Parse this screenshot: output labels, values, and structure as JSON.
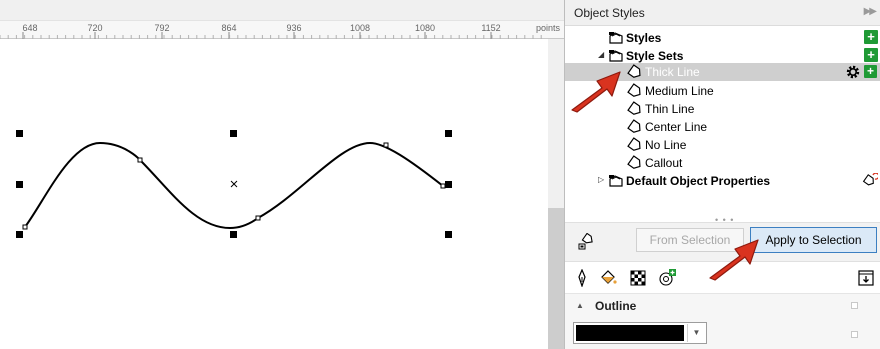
{
  "ruler": {
    "labels": [
      "648",
      "720",
      "792",
      "864",
      "936",
      "1008",
      "1080",
      "1152"
    ],
    "unit": "points"
  },
  "docker": {
    "title": "Object Styles",
    "collapse_icon": "double-chevron-right-icon"
  },
  "tree": {
    "styles_label": "Styles",
    "style_sets_label": "Style Sets",
    "items": [
      {
        "label": "Thick Line",
        "selected": true
      },
      {
        "label": "Medium Line",
        "selected": false
      },
      {
        "label": "Thin Line",
        "selected": false
      },
      {
        "label": "Center Line",
        "selected": false
      },
      {
        "label": "No Line",
        "selected": false
      },
      {
        "label": "Callout",
        "selected": false
      }
    ],
    "default_props_label": "Default Object Properties"
  },
  "apply": {
    "from_selection_label": "From Selection",
    "apply_to_selection_label": "Apply to Selection"
  },
  "outline": {
    "title": "Outline",
    "color": "#000000"
  },
  "colors": {
    "accent_green": "#1f9a35",
    "annotation_red": "#d9331f",
    "selection_gray": "#cfcfcf",
    "apply_button_border": "#3c7fc1"
  }
}
